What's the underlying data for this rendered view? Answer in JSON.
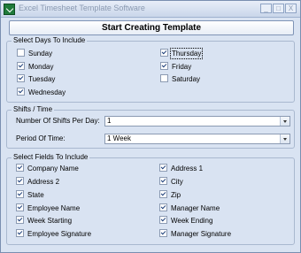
{
  "window": {
    "title": "Excel Timesheet Template Software",
    "minimize_label": "_",
    "maximize_label": "□",
    "close_label": "X"
  },
  "start_button": {
    "label": "Start Creating Template"
  },
  "days_group": {
    "legend": "Select Days To Include",
    "items": [
      {
        "label": "Sunday",
        "checked": false
      },
      {
        "label": "Monday",
        "checked": true
      },
      {
        "label": "Tuesday",
        "checked": true
      },
      {
        "label": "Wednesday",
        "checked": true
      },
      {
        "label": "Thursday",
        "checked": true
      },
      {
        "label": "Friday",
        "checked": true
      },
      {
        "label": "Saturday",
        "checked": false
      }
    ]
  },
  "shifts_group": {
    "legend": "Shifts / Time",
    "shifts_label": "Number Of Shifts Per Day:",
    "shifts_value": "1",
    "period_label": "Period Of Time:",
    "period_value": "1 Week"
  },
  "fields_group": {
    "legend": "Select Fields To Include",
    "items": [
      {
        "label": "Company Name",
        "checked": true
      },
      {
        "label": "Address 2",
        "checked": true
      },
      {
        "label": "State",
        "checked": true
      },
      {
        "label": "Employee Name",
        "checked": true
      },
      {
        "label": "Week Starting",
        "checked": true
      },
      {
        "label": "Employee Signature",
        "checked": true
      },
      {
        "label": "Address 1",
        "checked": true
      },
      {
        "label": "City",
        "checked": true
      },
      {
        "label": "Zip",
        "checked": true
      },
      {
        "label": "Manager Name",
        "checked": true
      },
      {
        "label": "Week Ending",
        "checked": true
      },
      {
        "label": "Manager Signature",
        "checked": true
      }
    ]
  }
}
